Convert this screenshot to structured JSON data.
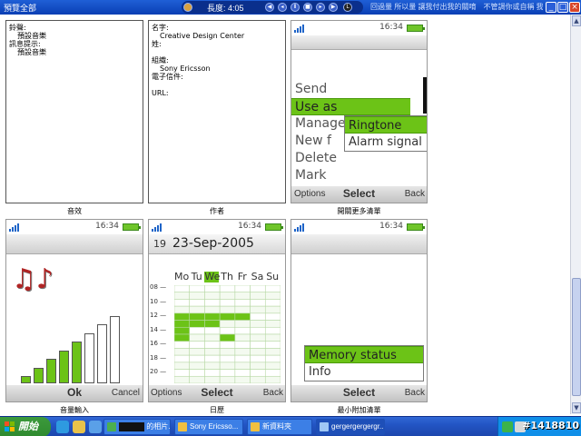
{
  "window": {
    "title": "預覽全部",
    "media_player": {
      "track": "長度: 4:05"
    },
    "ticker": "回過量 所以量 讓我付出我的關唷　不管調你或自稱 我"
  },
  "panels": {
    "sound": {
      "label": "音效",
      "fields": [
        {
          "label": "鈴聲:",
          "value": "預設音樂"
        },
        {
          "label": "訊息提示:",
          "value": "預設音樂"
        }
      ]
    },
    "author": {
      "label": "作者",
      "fields": [
        {
          "label": "名字:",
          "value": "Creative Design Center"
        },
        {
          "label": "姓:",
          "value": ""
        },
        {
          "label": "組織:",
          "value": "Sony Ericsson"
        },
        {
          "label": "電子信件:",
          "value": ""
        },
        {
          "label": "URL:",
          "value": ""
        }
      ]
    },
    "more_menu": {
      "label": "開關更多清單",
      "clock": "16:34",
      "items": [
        "Send",
        "Use as",
        "Manage",
        "New f",
        "Delete",
        "Mark"
      ],
      "selected": "Use as",
      "submenu": [
        "Ringtone",
        "Alarm signal"
      ],
      "submenu_selected": "Ringtone",
      "softkeys": {
        "left": "Options",
        "mid": "Select",
        "right": "Back"
      }
    },
    "volume": {
      "label": "音量輸入",
      "clock": "16:34",
      "level_bars_filled": 5,
      "level_bars_total": 8,
      "softkeys": {
        "mid": "Ok",
        "right": "Cancel"
      }
    },
    "calendar": {
      "label": "日歷",
      "clock": "16:34",
      "week": "19",
      "date": "23-Sep-2005",
      "days": [
        "Mo",
        "Tu",
        "We",
        "Th",
        "Fr",
        "Sa",
        "Su"
      ],
      "selected_day": "We",
      "hours": [
        "08",
        "10",
        "12",
        "14",
        "16",
        "18",
        "20"
      ],
      "softkeys": {
        "left": "Options",
        "mid": "Select",
        "right": "Back"
      }
    },
    "mini_menu": {
      "label": "最小附加清單",
      "clock": "16:34",
      "items": [
        "Memory status",
        "Info"
      ],
      "selected": "Memory status",
      "softkeys": {
        "mid": "Select",
        "right": "Back"
      }
    }
  },
  "taskbar": {
    "start": "開始",
    "buttons": [
      {
        "label": "的相片..."
      },
      {
        "label": "Sony Ericsso..."
      },
      {
        "label": "新資料夾"
      },
      {
        "label": "gergergergergr..."
      }
    ],
    "watermark": "#1418810"
  },
  "colors": {
    "accent_green": "#6cc317",
    "title_blue": "#0a3fb4",
    "taskbar_blue": "#2355c4",
    "start_green": "#2f8a2f"
  }
}
